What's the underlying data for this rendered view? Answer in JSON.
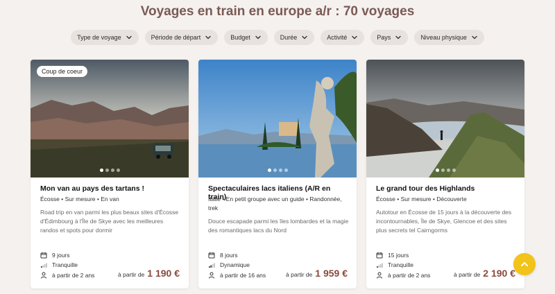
{
  "page": {
    "title": "Voyages en train en europe a/r : 70 voyages"
  },
  "filters": [
    {
      "label": "Type de voyage",
      "icon": "chevron-down-icon"
    },
    {
      "label": "Période de départ",
      "icon": "chevron-down-icon"
    },
    {
      "label": "Budget",
      "icon": "chevron-down-icon"
    },
    {
      "label": "Durée",
      "icon": "chevron-down-icon"
    },
    {
      "label": "Activité",
      "icon": "chevron-down-icon"
    },
    {
      "label": "Pays",
      "icon": "chevron-down-icon"
    },
    {
      "label": "Niveau physique",
      "icon": "chevron-down-icon"
    }
  ],
  "cards": [
    {
      "badge": "Coup de coeur",
      "title": "Mon van au pays des tartans !",
      "tags": "Écosse  •  Sur mesure  •  En van",
      "description": "Road trip en van parmi les plus beaux sites d'Écosse d'Édimbourg à l'Île de Skye avec les meilleures randos et spots pour dormir",
      "duration": "9 jours",
      "level": "Tranquille",
      "age": "à partir de 2 ans",
      "price_prefix": "à partir de",
      "price": "1 190 €",
      "carousel_dots": 4,
      "carousel_active": 1
    },
    {
      "badge": "",
      "title": "Spectaculaires lacs italiens (A/R en train)",
      "tags": "Italie  •  En petit groupe avec un guide  •  Randonnée, trek",
      "description": "Douce escapade parmi les îles lombardes et la magie des romantiques lacs du Nord",
      "duration": "8 jours",
      "level": "Dynamique",
      "age": "à partir de 16 ans",
      "price_prefix": "à partir de",
      "price": "1 959 €",
      "carousel_dots": 4,
      "carousel_active": 1
    },
    {
      "badge": "",
      "title": "Le grand tour des Highlands",
      "tags": "Écosse  •  Sur mesure  •  Découverte",
      "description": "Autotour en Écosse de 15 jours à la découverte des incontournables, Île de Skye, Glencoe et des sites plus secrets tel Cairngorms",
      "duration": "15 jours",
      "level": "Tranquille",
      "age": "à partir de 2 ans",
      "price_prefix": "à partir de",
      "price": "2 190 €",
      "carousel_dots": 4,
      "carousel_active": 1
    }
  ],
  "icons": {
    "calendar": "calendar-icon",
    "level": "level-bars-icon",
    "person": "person-icon",
    "scroll_top": "chevron-up-icon"
  },
  "colors": {
    "title": "#7a5a55",
    "price": "#8a4a3a",
    "scroll_button": "#f2c318",
    "background": "#f5f1ee"
  }
}
